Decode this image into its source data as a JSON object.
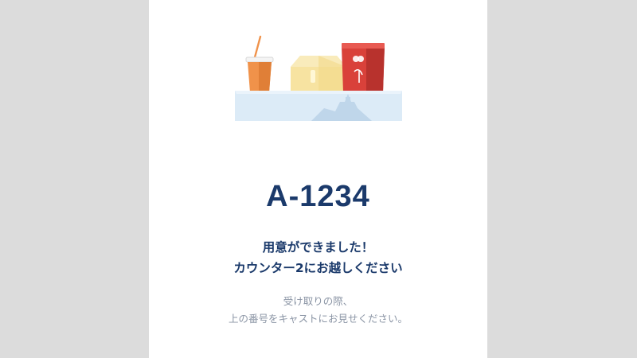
{
  "order": {
    "number": "A-1234"
  },
  "message": {
    "line1": "用意ができました！",
    "line2": "カウンター2にお越しください"
  },
  "instruction": {
    "line1": "受け取りの際、",
    "line2": "上の番号をキャストにお見せください。"
  },
  "illustration": {
    "icon": "food-tray-illustration",
    "colors": {
      "tray": "#dcebf7",
      "drink": "#f0924a",
      "straw": "#f0924a",
      "sandwich": "#f7e3a1",
      "box": "#d9413a",
      "text": "#1b3a6b"
    }
  }
}
